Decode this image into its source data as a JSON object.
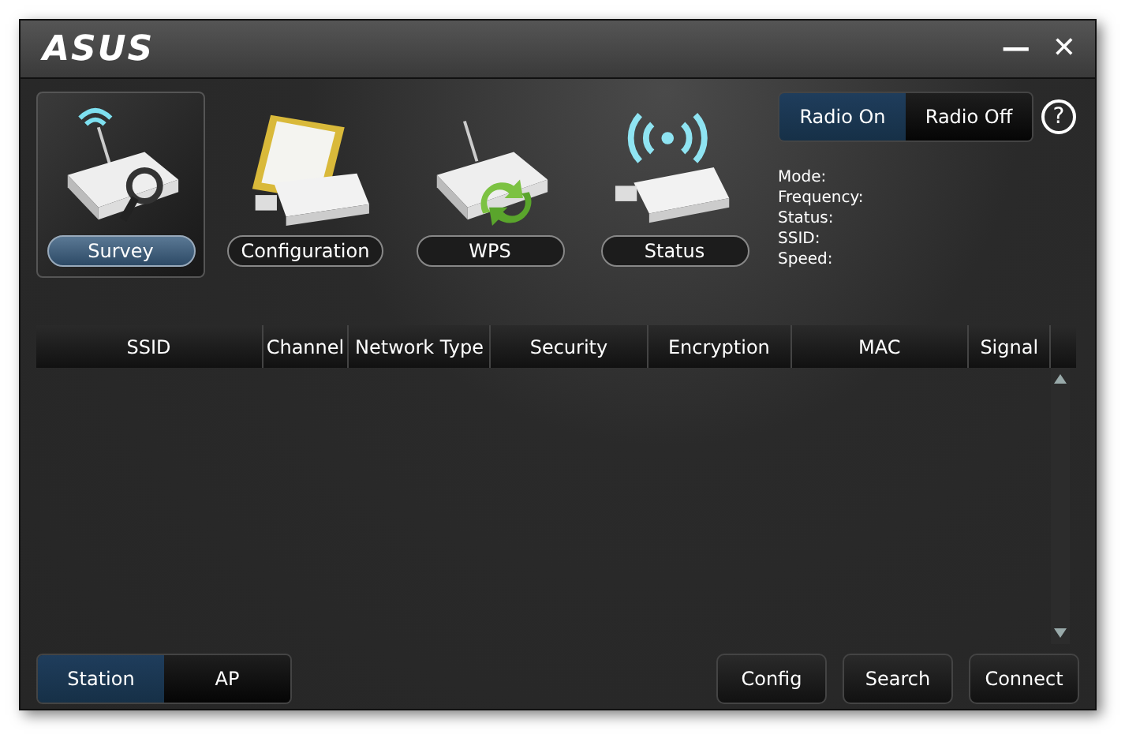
{
  "window": {
    "logo": "ASUS",
    "minimize": "—",
    "close": "✕"
  },
  "nav": [
    {
      "kind": "survey",
      "label": "Survey",
      "selected": true
    },
    {
      "kind": "configuration",
      "label": "Configuration",
      "selected": false
    },
    {
      "kind": "wps",
      "label": "WPS",
      "selected": false
    },
    {
      "kind": "status",
      "label": "Status",
      "selected": false
    }
  ],
  "radio": [
    {
      "label": "Radio On",
      "selected": true
    },
    {
      "label": "Radio Off",
      "selected": false
    }
  ],
  "help": "?",
  "info": [
    "Mode:",
    "Frequency:",
    "Status:",
    "SSID:",
    "Speed:"
  ],
  "table": {
    "columns": [
      "SSID",
      "Channel",
      "Network Type",
      "Security",
      "Encryption",
      "MAC",
      "Signal"
    ]
  },
  "mode": [
    {
      "label": "Station",
      "selected": true
    },
    {
      "label": "AP",
      "selected": false
    }
  ],
  "buttons": [
    "Config",
    "Search",
    "Connect"
  ]
}
